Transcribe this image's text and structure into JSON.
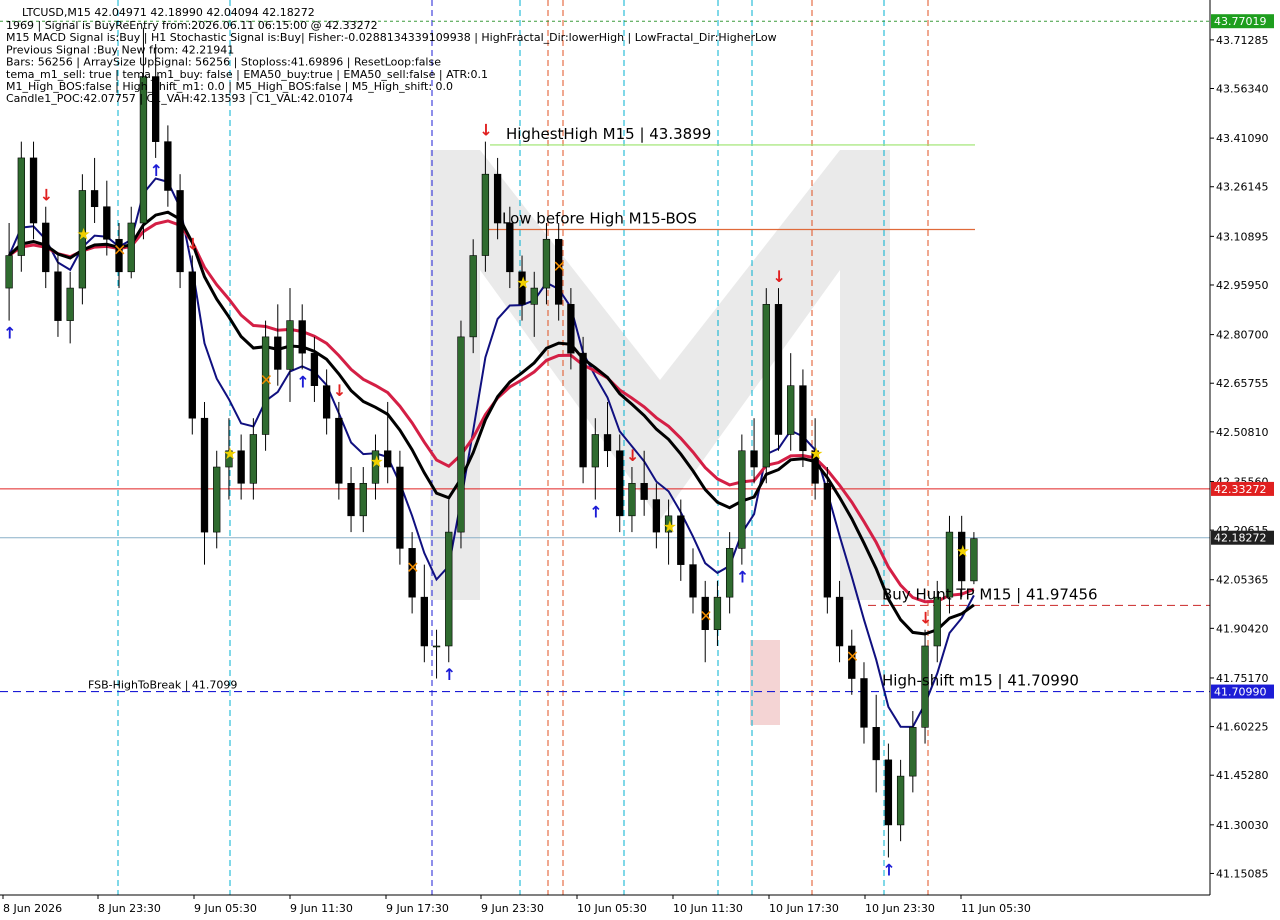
{
  "chart_data": {
    "type": "candlestick",
    "symbol_line": "LTCUSD,M15  42.04971 42.18990 42.04094 42.18272",
    "info_lines": [
      "1969 | Signal is BuyReEntry from:2026.06.11 06:15:00 @ 42.33272",
      "M15 MACD Signal is:Buy | H1 Stochastic Signal is:Buy| Fisher:-0.0288134339109938 | HighFractal_Dir:lowerHigh | LowFractal_Dir:HigherLow",
      "Previous Signal :Buy New from: 42.21941",
      "Bars: 56256 | ArraySize UpSignal: 56256 | Stoploss:41.69896 | ResetLoop:false",
      "tema_m1_sell: true | tema_m1_buy: false | EMA50_buy:true | EMA50_sell:false | ATR:0.1",
      "M1_High_BOS:false | High_shift_m1: 0.0 | M5_High_BOS:false | M5_High_shift: 0.0",
      "Candle1_POC:42.07757 | C1_VAH:42.13593 | C1_VAL:42.01074"
    ],
    "y_ticks": [
      "43.71285",
      "43.56340",
      "43.41090",
      "43.26145",
      "43.10895",
      "42.95950",
      "42.80700",
      "42.65755",
      "42.50810",
      "42.35560",
      "42.20615",
      "42.05365",
      "41.90420",
      "41.75170",
      "41.60225",
      "41.45280",
      "41.30030",
      "41.15085"
    ],
    "x_ticks": [
      "8 Jun 2026",
      "8 Jun 23:30",
      "9 Jun 05:30",
      "9 Jun 11:30",
      "9 Jun 17:30",
      "9 Jun 23:30",
      "10 Jun 05:30",
      "10 Jun 11:30",
      "10 Jun 17:30",
      "10 Jun 23:30",
      "11 Jun 05:30"
    ],
    "ylim": [
      41.1,
      43.82
    ],
    "price_tags": [
      {
        "value": 43.77019,
        "label": "43.77019",
        "color": "#1e9e1e"
      },
      {
        "value": 42.33272,
        "label": "42.33272",
        "color": "#e02020"
      },
      {
        "value": 42.18272,
        "label": "42.18272",
        "color": "#202020"
      },
      {
        "value": 41.7099,
        "label": "41.70990",
        "color": "#1c1cd6"
      }
    ],
    "levels": [
      {
        "label": "HighestHigh   M15 | 43.3899",
        "value": 43.3899,
        "color": "#9be36b"
      },
      {
        "label": "Low before High   M15-BOS",
        "value": 43.13,
        "color": "#e06a3a"
      },
      {
        "label": "Buy Hunt TP M15 | 41.97456",
        "value": 41.97456,
        "color": "#d04040"
      },
      {
        "label": "High-shift m15 | 41.70990",
        "value": 41.7099,
        "color": "#1c1cd6"
      },
      {
        "label": "FSB-HighToBreak | 41.7099",
        "value": 41.7099,
        "color": "#1c1cd6"
      }
    ],
    "candles": [
      [
        42.95,
        43.15,
        42.85,
        43.05
      ],
      [
        43.05,
        43.4,
        43.0,
        43.35
      ],
      [
        43.35,
        43.4,
        43.1,
        43.15
      ],
      [
        43.15,
        43.2,
        42.95,
        43.0
      ],
      [
        43.0,
        43.05,
        42.8,
        42.85
      ],
      [
        42.85,
        43.0,
        42.78,
        42.95
      ],
      [
        42.95,
        43.3,
        42.9,
        43.25
      ],
      [
        43.25,
        43.35,
        43.15,
        43.2
      ],
      [
        43.2,
        43.28,
        43.05,
        43.1
      ],
      [
        43.1,
        43.15,
        42.95,
        43.0
      ],
      [
        43.0,
        43.2,
        42.98,
        43.15
      ],
      [
        43.15,
        43.75,
        43.1,
        43.6
      ],
      [
        43.6,
        43.7,
        43.35,
        43.4
      ],
      [
        43.4,
        43.45,
        43.2,
        43.25
      ],
      [
        43.25,
        43.3,
        42.95,
        43.0
      ],
      [
        43.0,
        43.05,
        42.5,
        42.55
      ],
      [
        42.55,
        42.6,
        42.1,
        42.2
      ],
      [
        42.2,
        42.45,
        42.15,
        42.4
      ],
      [
        42.4,
        42.55,
        42.3,
        42.45
      ],
      [
        42.45,
        42.5,
        42.3,
        42.35
      ],
      [
        42.35,
        42.55,
        42.3,
        42.5
      ],
      [
        42.5,
        42.85,
        42.45,
        42.8
      ],
      [
        42.8,
        42.9,
        42.65,
        42.7
      ],
      [
        42.7,
        42.95,
        42.6,
        42.85
      ],
      [
        42.85,
        42.9,
        42.7,
        42.75
      ],
      [
        42.75,
        42.8,
        42.6,
        42.65
      ],
      [
        42.65,
        42.7,
        42.5,
        42.55
      ],
      [
        42.55,
        42.6,
        42.3,
        42.35
      ],
      [
        42.35,
        42.4,
        42.2,
        42.25
      ],
      [
        42.25,
        42.4,
        42.2,
        42.35
      ],
      [
        42.35,
        42.5,
        42.3,
        42.45
      ],
      [
        42.45,
        42.6,
        42.35,
        42.4
      ],
      [
        42.4,
        42.45,
        42.1,
        42.15
      ],
      [
        42.15,
        42.2,
        41.95,
        42.0
      ],
      [
        42.0,
        42.1,
        41.8,
        41.85
      ],
      [
        41.85,
        41.9,
        41.75,
        41.85
      ],
      [
        41.85,
        42.3,
        41.8,
        42.2
      ],
      [
        42.2,
        42.85,
        42.15,
        42.8
      ],
      [
        42.8,
        43.1,
        42.75,
        43.05
      ],
      [
        43.05,
        43.4,
        43.0,
        43.3
      ],
      [
        43.3,
        43.35,
        43.1,
        43.15
      ],
      [
        43.15,
        43.2,
        42.95,
        43.0
      ],
      [
        43.0,
        43.05,
        42.85,
        42.9
      ],
      [
        42.9,
        43.0,
        42.8,
        42.95
      ],
      [
        42.95,
        43.15,
        42.9,
        43.1
      ],
      [
        43.1,
        43.15,
        42.85,
        42.9
      ],
      [
        42.9,
        42.95,
        42.7,
        42.75
      ],
      [
        42.75,
        42.8,
        42.35,
        42.4
      ],
      [
        42.4,
        42.55,
        42.3,
        42.5
      ],
      [
        42.5,
        42.6,
        42.4,
        42.45
      ],
      [
        42.45,
        42.5,
        42.2,
        42.25
      ],
      [
        42.25,
        42.4,
        42.2,
        42.35
      ],
      [
        42.35,
        42.45,
        42.25,
        42.3
      ],
      [
        42.3,
        42.35,
        42.15,
        42.2
      ],
      [
        42.2,
        42.3,
        42.1,
        42.25
      ],
      [
        42.25,
        42.3,
        42.05,
        42.1
      ],
      [
        42.1,
        42.15,
        41.95,
        42.0
      ],
      [
        42.0,
        42.05,
        41.8,
        41.9
      ],
      [
        41.9,
        42.05,
        41.85,
        42.0
      ],
      [
        42.0,
        42.2,
        41.95,
        42.15
      ],
      [
        42.15,
        42.5,
        42.1,
        42.45
      ],
      [
        42.45,
        42.55,
        42.35,
        42.4
      ],
      [
        42.4,
        42.95,
        42.35,
        42.9
      ],
      [
        42.9,
        42.95,
        42.45,
        42.5
      ],
      [
        42.5,
        42.75,
        42.45,
        42.65
      ],
      [
        42.65,
        42.7,
        42.4,
        42.45
      ],
      [
        42.45,
        42.55,
        42.3,
        42.35
      ],
      [
        42.35,
        42.4,
        41.95,
        42.0
      ],
      [
        42.0,
        42.05,
        41.8,
        41.85
      ],
      [
        41.85,
        41.9,
        41.7,
        41.75
      ],
      [
        41.75,
        41.8,
        41.55,
        41.6
      ],
      [
        41.6,
        41.7,
        41.4,
        41.5
      ],
      [
        41.5,
        41.55,
        41.2,
        41.3
      ],
      [
        41.3,
        41.5,
        41.25,
        41.45
      ],
      [
        41.45,
        41.65,
        41.4,
        41.6
      ],
      [
        41.6,
        41.9,
        41.55,
        41.85
      ],
      [
        41.85,
        42.05,
        41.8,
        42.0
      ],
      [
        42.0,
        42.25,
        41.95,
        42.2
      ],
      [
        42.2,
        42.25,
        42.0,
        42.05
      ],
      [
        42.05,
        42.2,
        42.04,
        42.18
      ]
    ]
  }
}
